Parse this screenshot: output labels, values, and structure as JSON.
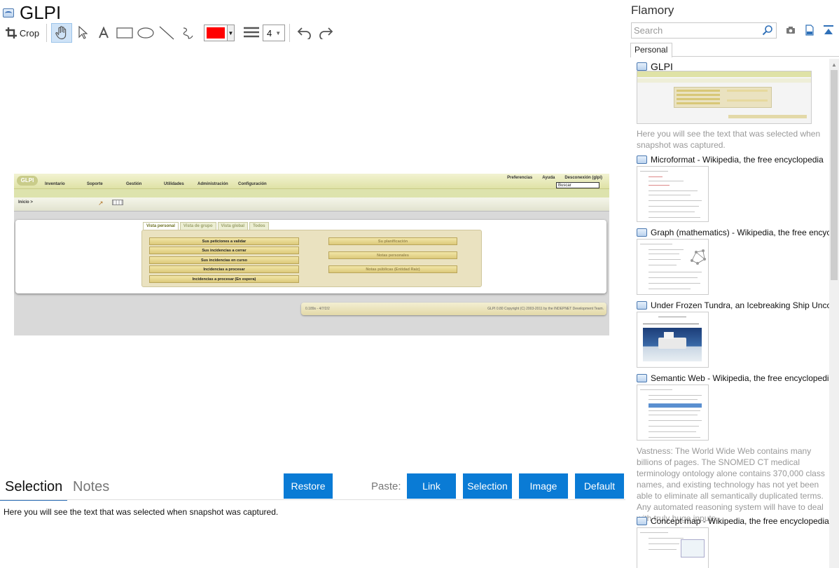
{
  "document": {
    "title": "GLPI"
  },
  "toolbar": {
    "crop_label": "Crop",
    "color": "#ff0000",
    "stroke_width": "4"
  },
  "snapshot": {
    "logo": "GLPI",
    "menu": [
      "Inventario",
      "Soporte",
      "Gestión",
      "Utilidades",
      "Administración",
      "Configuración"
    ],
    "top_links": [
      "Preferencias",
      "Ayuda",
      "Desconexión (glpi)"
    ],
    "search_value": "Buscar",
    "breadcrumb": "Inicio >",
    "tabs": [
      "Vista personal",
      "Vista de grupo",
      "Vista global",
      "Todos"
    ],
    "left_rows": [
      "Sus peticiones a validar",
      "Sus incidencias a cerrar",
      "Sus incidencias en curso",
      "Incidencias a procesar",
      "Incidencias a procesar (En espera)"
    ],
    "right_rows": [
      "Su planificación",
      "Notas personales",
      "Notas públicas (Entidad Raíz)"
    ],
    "footer_left": "0.189s - 4/7/2/2",
    "footer_right": "GLPI 0.80 Copyright (C) 2003-2011 by the INDEPNET Development Team."
  },
  "bottom": {
    "tab_selection": "Selection",
    "tab_notes": "Notes",
    "restore_label": "Restore",
    "paste_label": "Paste:",
    "paste_buttons": [
      "Link",
      "Selection",
      "Image",
      "Default"
    ],
    "selection_text": "Here you will see the text that was selected when snapshot was captured."
  },
  "sidebar": {
    "brand": "Flamory",
    "search_placeholder": "Search",
    "tab": "Personal",
    "items": [
      {
        "title": "GLPI",
        "desc": "Here you will see the text that was selected when snapshot was captured."
      },
      {
        "title": "Microformat - Wikipedia, the free encyclopedia"
      },
      {
        "title": "Graph (mathematics) - Wikipedia, the free encyclopedia"
      },
      {
        "title": "Under Frozen Tundra, an Icebreaking Ship Uncovers..."
      },
      {
        "title": "Semantic Web - Wikipedia, the free encyclopedia",
        "desc": "Vastness: The World Wide Web contains many billions of pages. The SNOMED CT medical terminology ontology alone contains 370,000 class names, and existing technology has not yet been able to eliminate all semantically duplicated terms. Any automated reasoning system will have to deal with truly huge inputs."
      },
      {
        "title": "Concept map - Wikipedia, the free encyclopedia"
      }
    ]
  },
  "colors": {
    "accent": "#0a7bd5",
    "tab_underline": "#2f70b8"
  }
}
